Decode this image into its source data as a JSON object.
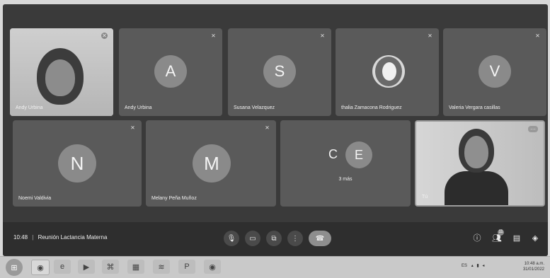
{
  "tiles": {
    "t1": {
      "name": "Andy Urbina"
    },
    "t2": {
      "name": "Andy Urbina",
      "initial": "A"
    },
    "t3": {
      "name": "Susana Velazquez",
      "initial": "S"
    },
    "t4": {
      "name": "thalia Zamacona Rodriguez"
    },
    "t5": {
      "name": "Valeria Vergara casillas",
      "initial": "V"
    },
    "t6": {
      "name": "Noemi Valdivia",
      "initial": "N"
    },
    "t7": {
      "name": "Melany Peña Muñoz",
      "initial": "M"
    },
    "t8": {
      "initial_1": "C",
      "initial_2": "E",
      "more": "3 más"
    },
    "t9": {
      "name": "Tú"
    }
  },
  "bottom_bar": {
    "time": "10:48",
    "separator": "|",
    "meeting_title": "Reunión Lactancia Materna",
    "participants_badge": "11"
  },
  "taskbar": {
    "language": "ES",
    "clock_time": "10:48 a.m.",
    "clock_date": "31/01/2022"
  },
  "colors": {
    "tile": "#5a5a5a",
    "background": "#3a3a3a",
    "end_call": "#8e8e8e"
  },
  "icons": {
    "mute": "mic-off-icon",
    "mic": "mic-icon",
    "camera": "camera-icon",
    "present": "present-icon",
    "more": "more-vert-icon",
    "end_call": "end-call-icon",
    "info": "info-icon",
    "people": "people-icon",
    "chat": "chat-icon",
    "activities": "activities-icon"
  }
}
